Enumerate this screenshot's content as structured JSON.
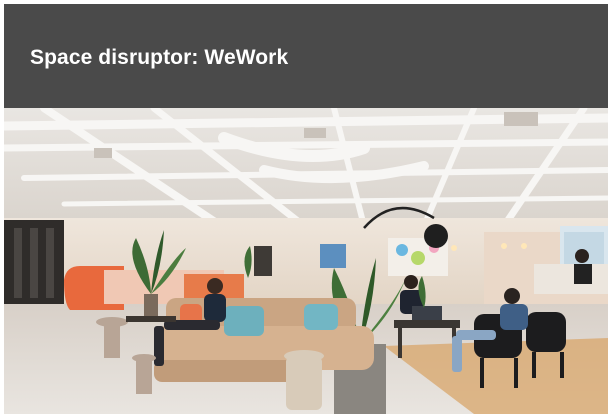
{
  "slide": {
    "title": "Space disruptor: WeWork",
    "title_bar_color": "#4a4a4a",
    "title_text_color": "#ffffff"
  },
  "photo": {
    "subject": "coworking-office-interior-photo"
  }
}
